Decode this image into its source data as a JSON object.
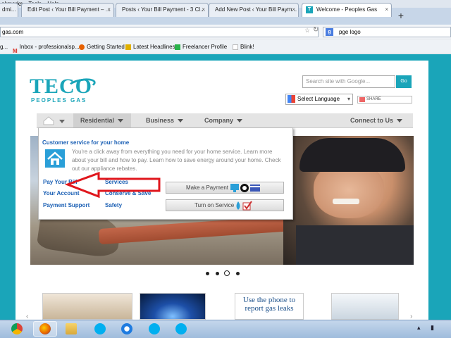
{
  "menubar": [
    "okmarks",
    "Tools",
    "Help"
  ],
  "tabs": [
    {
      "label": "dmi...",
      "active": false
    },
    {
      "label": "Edit Post ‹ Your Bill Payment – ...",
      "active": false
    },
    {
      "label": "Posts ‹ Your Bill Payment - 3 Cl...",
      "active": false
    },
    {
      "label": "Add New Post ‹ Your Bill Paym...",
      "active": false
    },
    {
      "label": "Welcome - Peoples Gas",
      "active": true
    }
  ],
  "newtab": "+",
  "address": {
    "url": "gas.com",
    "search_value": "pge logo",
    "search_engine_icon": "g"
  },
  "bookmarks": [
    {
      "label": "g...",
      "icon": "bookmark-icon",
      "color": "#888888"
    },
    {
      "label": "Inbox - professionalsp...",
      "icon": "gmail-icon",
      "color": "#d93025"
    },
    {
      "label": "Getting Started",
      "icon": "firefox-icon",
      "color": "#e66000"
    },
    {
      "label": "Latest Headlines",
      "icon": "rss-icon",
      "color": "#e0b000"
    },
    {
      "label": "Freelancer Profile",
      "icon": "freelancer-icon",
      "color": "#29b24a"
    },
    {
      "label": "Blink!",
      "icon": "blank-icon",
      "color": "#ffffff"
    }
  ],
  "site": {
    "logo_main": "TECO",
    "logo_sub": "PEOPLES GAS",
    "search_placeholder": "Search site with Google...",
    "search_button": "Go",
    "language": "Select Language",
    "share": "SHARE",
    "nav": [
      {
        "label": "Residential"
      },
      {
        "label": "Business"
      },
      {
        "label": "Company"
      },
      {
        "label": "Connect to Us"
      }
    ],
    "dropdown": {
      "title": "Customer service for your home",
      "text": "You're a click away from everything you need for your home service. Learn more about your bill and how to pay. Learn how to save energy around your home. Check out our appliance rebates.",
      "col1": [
        "Pay Your Bill",
        "Your Account",
        "Payment Support"
      ],
      "col2": [
        "Services",
        "Conserve & Save",
        "Safety"
      ],
      "buttons": [
        "Make a Payment",
        "Turn on Service"
      ]
    },
    "carousel_dots": 4,
    "carousel_active": 3,
    "tile3_text": "Use the phone to report gas leaks"
  },
  "colors": {
    "brand": "#1aa5b9",
    "link": "#1a5fb4",
    "annotation_arrow": "#e0161c"
  },
  "taskbar": [
    "chrome-icon",
    "firefox-icon",
    "explorer-icon",
    "skype-icon",
    "ie-icon",
    "skype-icon",
    "skype-icon"
  ]
}
